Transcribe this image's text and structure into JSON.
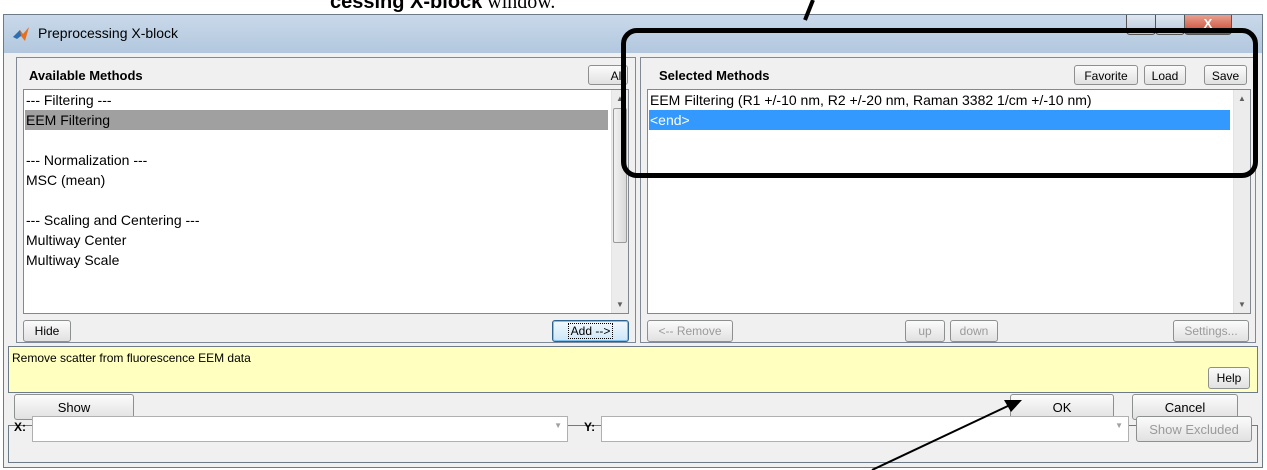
{
  "caption": {
    "bold": "cessing X-block",
    "normal": " window."
  },
  "window": {
    "title": "Preprocessing X-block",
    "close_glyph": "X"
  },
  "available": {
    "header": "Available Methods",
    "all_label": "All",
    "items": [
      "--- Filtering ---",
      "EEM Filtering",
      "",
      "--- Normalization ---",
      "MSC (mean)",
      "",
      "--- Scaling and Centering ---",
      "Multiway Center",
      "Multiway Scale"
    ],
    "selected_index": 1,
    "hide_label": "Hide",
    "add_label": "Add -->"
  },
  "selected": {
    "header": "Selected Methods",
    "favorite_label": "Favorite",
    "load_label": "Load",
    "save_label": "Save",
    "items": [
      "EEM Filtering (R1 +/-10 nm, R2 +/-20 nm, Raman 3382 1/cm +/-10 nm)",
      "<end>"
    ],
    "highlighted_index": 1,
    "remove_label": "<-- Remove",
    "up_label": "up",
    "down_label": "down",
    "settings_label": "Settings..."
  },
  "description": {
    "text": "Remove scatter from fluorescence EEM data",
    "help_label": "Help"
  },
  "bottom": {
    "show_label": "Show",
    "ok_label": "OK",
    "cancel_label": "Cancel"
  },
  "footer": {
    "x_label": "X:",
    "x_value": "",
    "y_label": "Y:",
    "y_value": "",
    "show_excluded_label": "Show Excluded"
  },
  "colors": {
    "list_selection": "#a0a0a0",
    "highlight": "#3399ff",
    "description_bg": "#ffffc0"
  }
}
